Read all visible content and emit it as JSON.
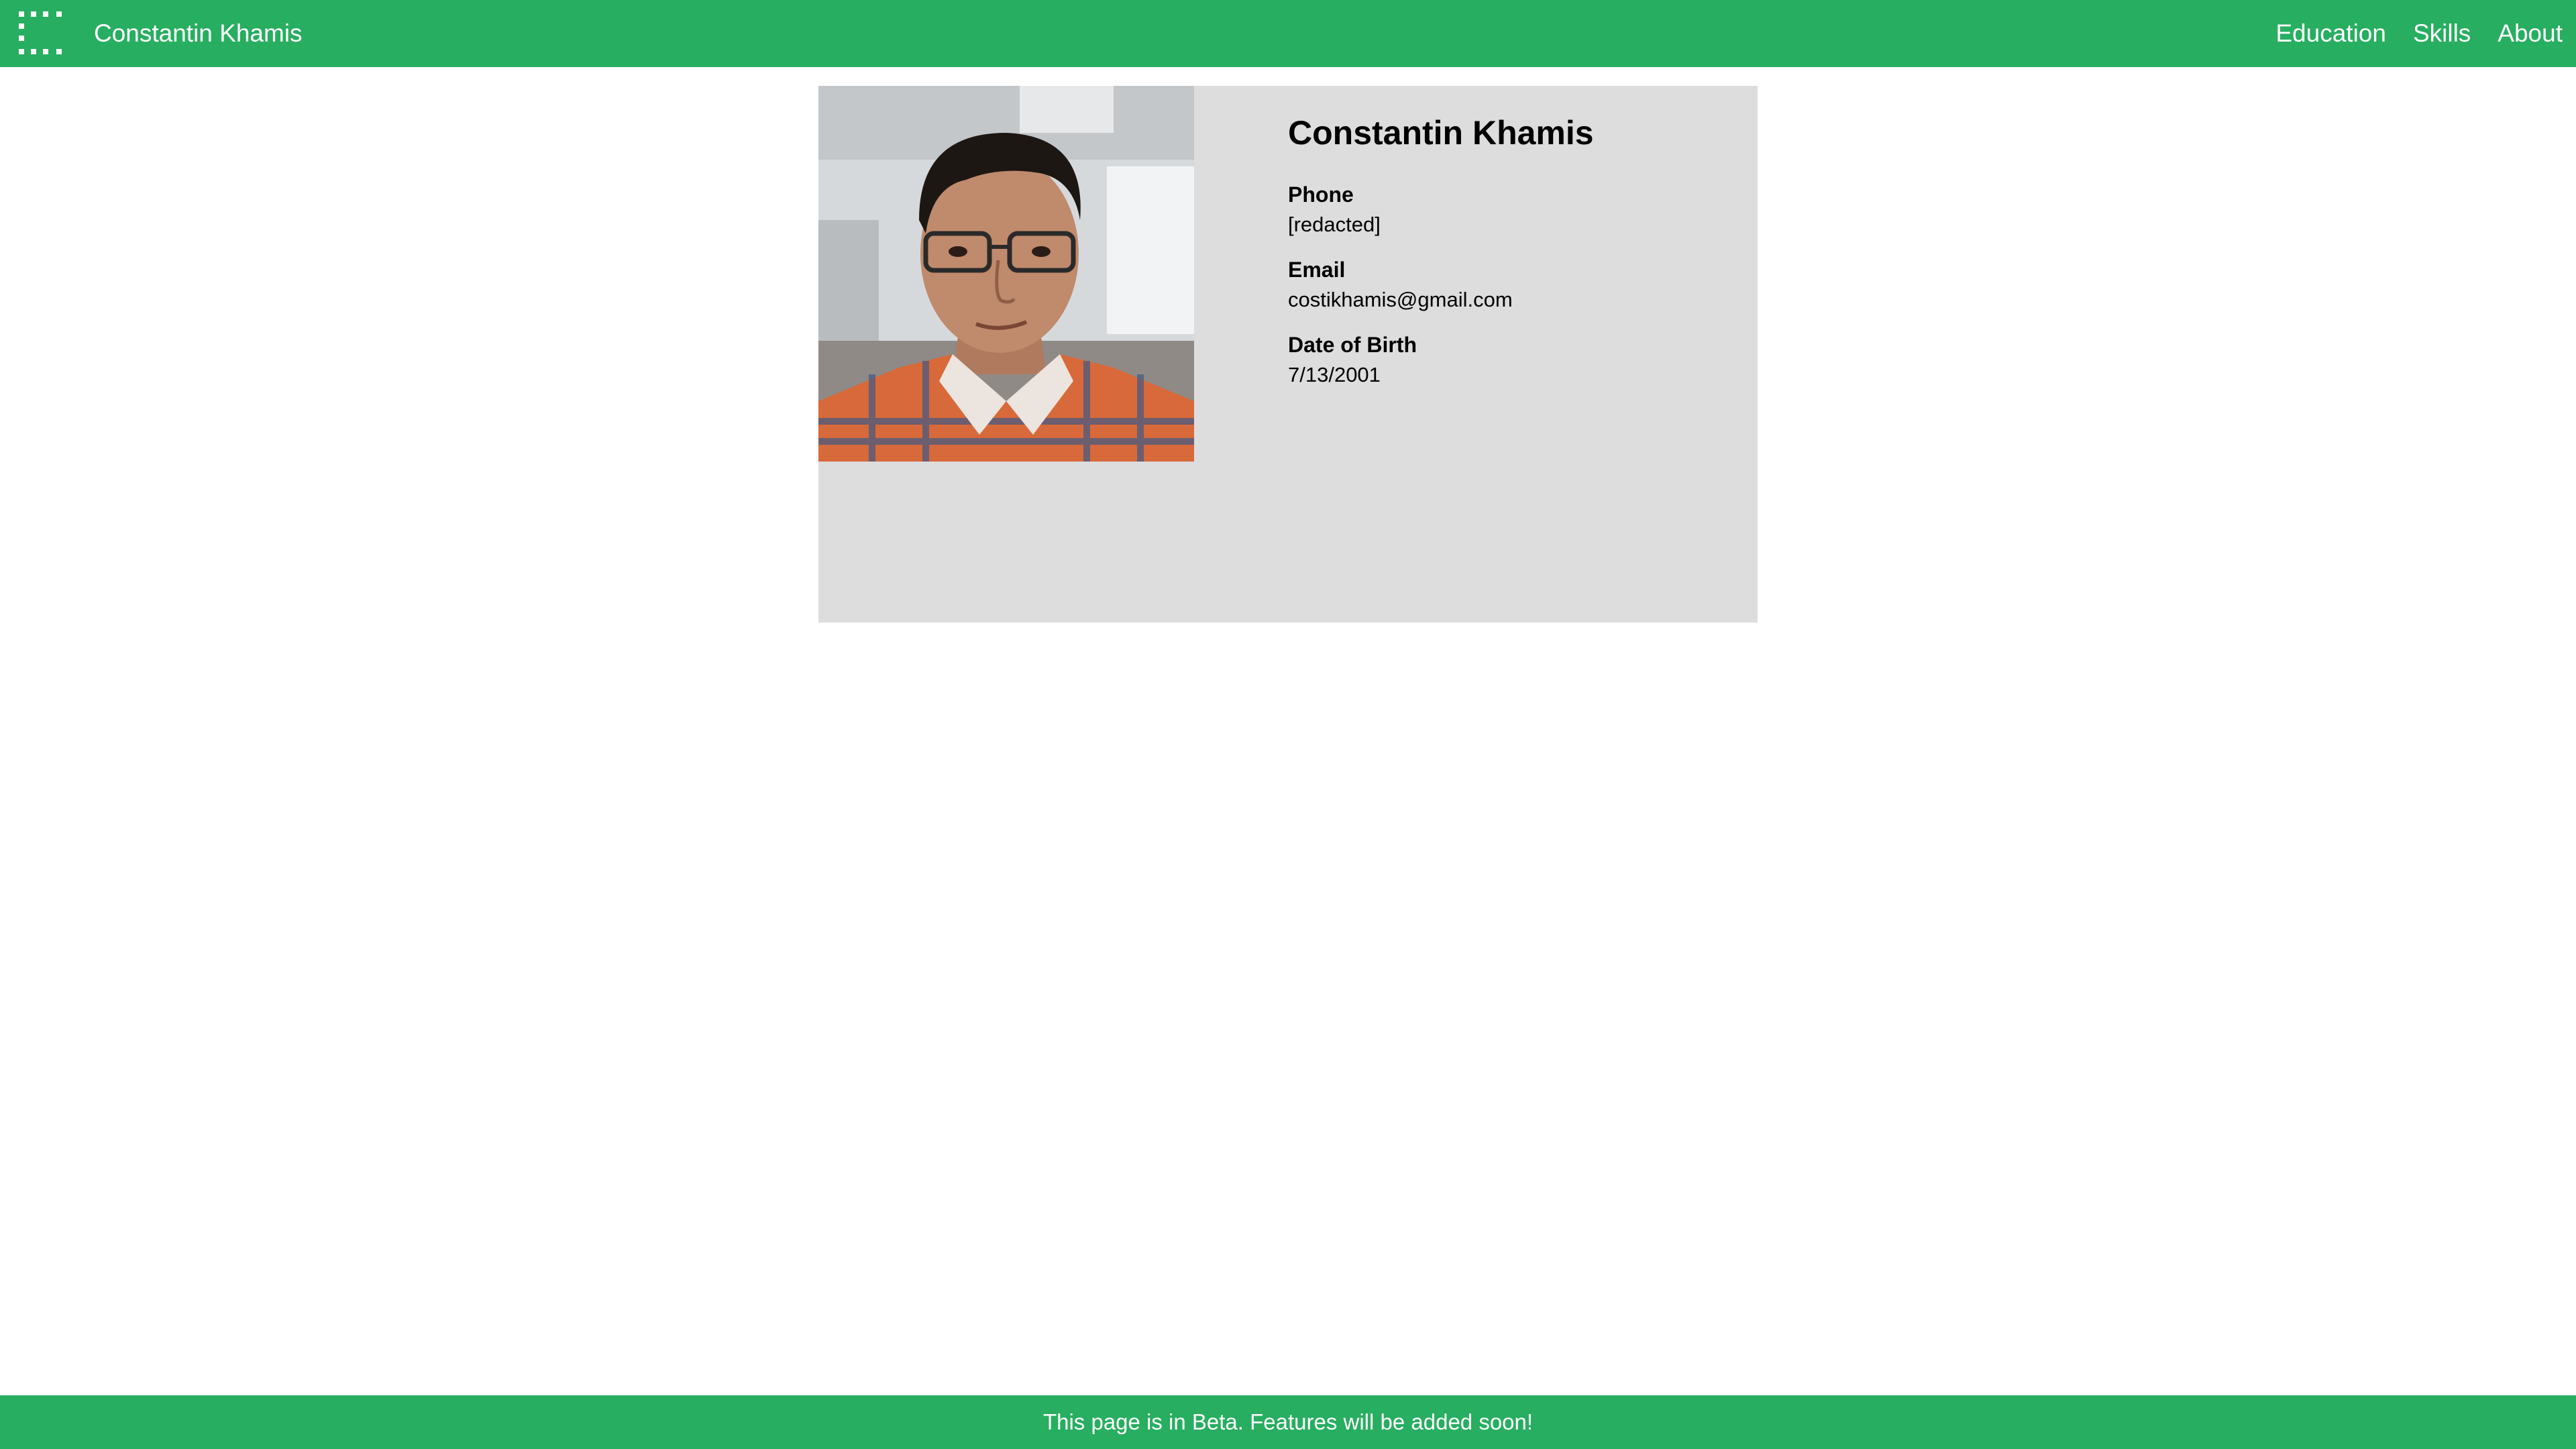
{
  "colors": {
    "accent": "#27ae60",
    "card_background": "#dddddd",
    "text_on_accent": "#ffffff"
  },
  "header": {
    "menu_icon": "grid-dots-icon",
    "title": "Constantin Khamis",
    "nav": [
      {
        "label": "Education"
      },
      {
        "label": "Skills"
      },
      {
        "label": "About"
      }
    ]
  },
  "profile": {
    "photo": "profile-photo",
    "name": "Constantin Khamis",
    "fields": [
      {
        "label": "Phone",
        "value": "[redacted]"
      },
      {
        "label": "Email",
        "value": "costikhamis@gmail.com"
      },
      {
        "label": "Date of Birth",
        "value": "7/13/2001"
      }
    ]
  },
  "footer": {
    "text": "This page is in Beta. Features will be added soon!"
  }
}
